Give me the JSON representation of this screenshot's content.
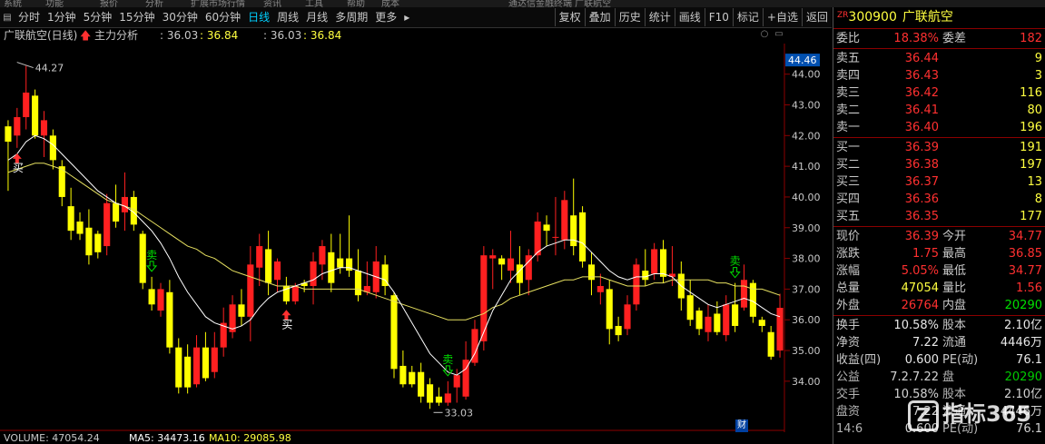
{
  "top_strip": [
    "系统",
    "功能",
    "报价",
    "分析",
    "扩展市场行情",
    "资讯",
    "工具",
    "帮助",
    "成本",
    "通达信金融终端 广联航空"
  ],
  "toolbar": {
    "periods": [
      "分时",
      "1分钟",
      "5分钟",
      "15分钟",
      "30分钟",
      "60分钟",
      "日线",
      "周线",
      "月线",
      "多周期",
      "更多"
    ],
    "active_period": "日线",
    "more_arrow": "▸",
    "tools": [
      "复权",
      "叠加",
      "历史",
      "统计",
      "画线",
      "F10",
      "标记",
      "+自选",
      "返回"
    ]
  },
  "infobar": {
    "title": "广联航空(日线)",
    "indicator": "主力分析",
    "val1": ": 36.03",
    "val2": ": 36.84",
    "val3": ": 36.03",
    "val4": ": 36.84"
  },
  "chart_data": {
    "type": "candlestick",
    "ylim": [
      33.7,
      44.7
    ],
    "yticks": [
      "44.00",
      "43.00",
      "42.00",
      "41.00",
      "40.00",
      "39.00",
      "38.00",
      "37.00",
      "36.00",
      "35.00",
      "34.00"
    ],
    "current_price_label": "44.46",
    "annotations": {
      "high_label": "44.27",
      "low_label": "33.03",
      "buy_label": "买",
      "sell_label": "卖"
    },
    "candles": [
      [
        42.3,
        41.8,
        42.5,
        40.2
      ],
      [
        42.0,
        42.6,
        42.9,
        41.6
      ],
      [
        42.6,
        43.4,
        44.27,
        42.2
      ],
      [
        43.3,
        42.0,
        43.5,
        41.9
      ],
      [
        42.0,
        42.5,
        42.8,
        41.3
      ],
      [
        42.0,
        41.2,
        42.2,
        40.9
      ],
      [
        41.0,
        40.0,
        41.2,
        39.7
      ],
      [
        39.7,
        38.9,
        40.3,
        38.6
      ],
      [
        39.2,
        38.8,
        39.5,
        38.6
      ],
      [
        39.0,
        38.1,
        39.6,
        37.8
      ],
      [
        38.8,
        38.2,
        38.9,
        38.0
      ],
      [
        38.4,
        39.8,
        40.1,
        38.1
      ],
      [
        39.8,
        39.2,
        40.4,
        39.0
      ],
      [
        39.5,
        40.0,
        40.8,
        38.9
      ],
      [
        40.0,
        39.1,
        40.2,
        38.9
      ],
      [
        38.8,
        37.2,
        38.9,
        37.0
      ],
      [
        37.0,
        36.5,
        37.4,
        36.3
      ],
      [
        36.3,
        37.0,
        37.2,
        36.1
      ],
      [
        36.9,
        35.1,
        37.3,
        34.9
      ],
      [
        35.1,
        33.8,
        35.4,
        33.6
      ],
      [
        34.8,
        33.8,
        35.2,
        33.6
      ],
      [
        33.9,
        35.1,
        35.5,
        33.8
      ],
      [
        35.1,
        34.1,
        35.6,
        34.0
      ],
      [
        34.3,
        35.1,
        35.6,
        34.1
      ],
      [
        35.1,
        35.9,
        36.4,
        34.8
      ],
      [
        35.6,
        36.5,
        36.8,
        35.4
      ],
      [
        36.5,
        36.1,
        37.0,
        35.8
      ],
      [
        36.1,
        37.8,
        38.4,
        35.3
      ],
      [
        37.7,
        38.4,
        38.8,
        37.1
      ],
      [
        38.3,
        37.2,
        38.9,
        36.8
      ],
      [
        37.3,
        37.9,
        38.0,
        36.9
      ],
      [
        37.1,
        36.6,
        37.4,
        36.5
      ],
      [
        36.6,
        37.1,
        37.2,
        36.5
      ],
      [
        37.2,
        37.1,
        37.3,
        36.9
      ],
      [
        37.1,
        37.9,
        38.2,
        36.5
      ],
      [
        37.8,
        38.4,
        38.6,
        37.3
      ],
      [
        38.2,
        37.2,
        38.8,
        36.9
      ],
      [
        38.0,
        37.7,
        38.8,
        37.5
      ],
      [
        38.0,
        37.6,
        39.4,
        37.4
      ],
      [
        37.6,
        36.8,
        38.3,
        36.6
      ],
      [
        36.9,
        37.1,
        37.9,
        36.8
      ],
      [
        36.9,
        37.9,
        38.4,
        36.7
      ],
      [
        37.8,
        37.1,
        38.1,
        36.8
      ],
      [
        36.8,
        34.4,
        36.9,
        34.1
      ],
      [
        34.5,
        33.9,
        35.0,
        33.8
      ],
      [
        34.3,
        33.9,
        34.5,
        33.8
      ],
      [
        34.3,
        33.5,
        34.6,
        33.3
      ],
      [
        33.9,
        33.3,
        34.1,
        33.1
      ],
      [
        33.5,
        33.3,
        33.8,
        33.2
      ],
      [
        33.3,
        33.6,
        34.0,
        33.2
      ],
      [
        33.8,
        34.2,
        34.4,
        33.3
      ],
      [
        33.5,
        34.7,
        35.3,
        33.4
      ],
      [
        34.6,
        35.7,
        36.0,
        34.5
      ],
      [
        35.3,
        38.1,
        38.4,
        35.0
      ],
      [
        38.0,
        38.1,
        38.3,
        37.0
      ],
      [
        38.0,
        37.8,
        38.1,
        37.3
      ],
      [
        37.6,
        38.0,
        38.9,
        37.2
      ],
      [
        37.8,
        37.2,
        38.4,
        36.8
      ],
      [
        37.3,
        38.1,
        38.3,
        36.8
      ],
      [
        38.1,
        39.2,
        39.5,
        37.9
      ],
      [
        39.1,
        38.9,
        39.4,
        38.4
      ],
      [
        38.7,
        38.7,
        40.0,
        38.1
      ],
      [
        38.6,
        39.9,
        40.2,
        38.3
      ],
      [
        39.4,
        38.4,
        40.6,
        38.1
      ],
      [
        39.5,
        37.9,
        39.7,
        37.7
      ],
      [
        37.8,
        37.3,
        38.2,
        36.8
      ],
      [
        36.9,
        37.1,
        37.5,
        36.5
      ],
      [
        37.0,
        35.7,
        37.3,
        35.2
      ],
      [
        35.8,
        35.5,
        36.1,
        35.3
      ],
      [
        35.7,
        36.5,
        36.8,
        35.5
      ],
      [
        36.5,
        37.8,
        38.0,
        36.3
      ],
      [
        37.6,
        37.3,
        38.3,
        37.1
      ],
      [
        37.5,
        38.3,
        38.5,
        37.3
      ],
      [
        38.3,
        37.4,
        38.6,
        37.2
      ],
      [
        37.4,
        37.5,
        38.4,
        37.1
      ],
      [
        37.5,
        36.7,
        37.9,
        36.3
      ],
      [
        36.8,
        36.0,
        37.3,
        35.8
      ],
      [
        36.3,
        35.7,
        36.4,
        35.5
      ],
      [
        35.6,
        36.1,
        36.5,
        35.3
      ],
      [
        36.2,
        35.6,
        36.6,
        35.5
      ],
      [
        35.5,
        36.5,
        36.8,
        35.3
      ],
      [
        36.5,
        35.8,
        37.2,
        35.6
      ],
      [
        36.4,
        37.3,
        37.8,
        36.3
      ],
      [
        37.2,
        36.1,
        37.3,
        35.9
      ],
      [
        36.0,
        35.8,
        36.1,
        35.6
      ],
      [
        35.6,
        34.8,
        35.8,
        34.7
      ],
      [
        35.0,
        36.39,
        36.85,
        34.77
      ]
    ],
    "ma": [
      41.2,
      41.4,
      41.8,
      42.0,
      41.9,
      41.7,
      41.4,
      41.1,
      40.8,
      40.5,
      40.2,
      40.0,
      39.8,
      39.7,
      39.5,
      39.2,
      38.9,
      38.5,
      38.0,
      37.4,
      36.9,
      36.5,
      36.1,
      35.9,
      35.8,
      35.7,
      35.8,
      36.0,
      36.4,
      36.7,
      36.9,
      37.0,
      37.1,
      37.2,
      37.3,
      37.5,
      37.6,
      37.7,
      37.7,
      37.6,
      37.5,
      37.4,
      37.3,
      36.9,
      36.4,
      35.9,
      35.4,
      34.9,
      34.6,
      34.3,
      34.2,
      34.4,
      34.9,
      35.6,
      36.3,
      36.8,
      37.3,
      37.6,
      37.9,
      38.2,
      38.4,
      38.5,
      38.6,
      38.6,
      38.5,
      38.2,
      37.9,
      37.6,
      37.4,
      37.3,
      37.4,
      37.4,
      37.5,
      37.5,
      37.4,
      37.1,
      36.9,
      36.7,
      36.5,
      36.4,
      36.5,
      36.6,
      36.7,
      36.6,
      36.4,
      36.2,
      36.1
    ],
    "ma2": [
      40.8,
      40.9,
      41.0,
      41.1,
      41.1,
      41.0,
      40.9,
      40.7,
      40.5,
      40.3,
      40.1,
      39.9,
      39.8,
      39.7,
      39.6,
      39.4,
      39.2,
      39.0,
      38.8,
      38.6,
      38.4,
      38.3,
      38.1,
      38.0,
      37.8,
      37.6,
      37.5,
      37.4,
      37.3,
      37.2,
      37.1,
      37.1,
      37.1,
      37.0,
      37.0,
      37.0,
      37.0,
      37.0,
      37.0,
      37.0,
      36.9,
      36.8,
      36.7,
      36.6,
      36.5,
      36.4,
      36.3,
      36.2,
      36.1,
      36.0,
      36.0,
      36.0,
      36.1,
      36.2,
      36.4,
      36.5,
      36.7,
      36.8,
      36.9,
      37.0,
      37.1,
      37.2,
      37.3,
      37.3,
      37.4,
      37.4,
      37.4,
      37.3,
      37.2,
      37.1,
      37.1,
      37.1,
      37.2,
      37.2,
      37.3,
      37.3,
      37.3,
      37.3,
      37.3,
      37.2,
      37.2,
      37.1,
      37.1,
      37.0,
      37.0,
      36.9,
      36.8
    ],
    "buy_marks": [
      1,
      31
    ],
    "sell_marks": [
      16,
      49,
      81
    ]
  },
  "quote": {
    "code": "300900",
    "name": "广联航空",
    "zr": "ZR",
    "weibi_label": "委比",
    "weibi": "18.38%",
    "weicha_label": "委差",
    "weicha": "182",
    "sells": [
      {
        "label": "卖五",
        "price": "36.44",
        "vol": "9"
      },
      {
        "label": "卖四",
        "price": "36.43",
        "vol": "3"
      },
      {
        "label": "卖三",
        "price": "36.42",
        "vol": "116"
      },
      {
        "label": "卖二",
        "price": "36.41",
        "vol": "80"
      },
      {
        "label": "卖一",
        "price": "36.40",
        "vol": "196"
      }
    ],
    "buys": [
      {
        "label": "买一",
        "price": "36.39",
        "vol": "191"
      },
      {
        "label": "买二",
        "price": "36.38",
        "vol": "197"
      },
      {
        "label": "买三",
        "price": "36.37",
        "vol": "13"
      },
      {
        "label": "买四",
        "price": "36.36",
        "vol": "8"
      },
      {
        "label": "买五",
        "price": "36.35",
        "vol": "177"
      }
    ],
    "stats": [
      {
        "l1": "现价",
        "v1": "36.39",
        "c1": "red",
        "l2": "今开",
        "v2": "34.77",
        "c2": "red"
      },
      {
        "l1": "涨跌",
        "v1": "1.75",
        "c1": "red",
        "l2": "最高",
        "v2": "36.85",
        "c2": "red"
      },
      {
        "l1": "涨幅",
        "v1": "5.05%",
        "c1": "red",
        "l2": "最低",
        "v2": "34.77",
        "c2": "red"
      },
      {
        "l1": "总量",
        "v1": "47054",
        "c1": "yellow",
        "l2": "量比",
        "v2": "1.56",
        "c2": "red"
      },
      {
        "l1": "外盘",
        "v1": "26764",
        "c1": "red",
        "l2": "内盘",
        "v2": "20290",
        "c2": "green"
      }
    ],
    "stats2": [
      {
        "l1": "换手",
        "v1": "10.58%",
        "l2": "股本",
        "v2": "2.10亿"
      },
      {
        "l1": "净资",
        "v1": "7.22",
        "l2": "流通",
        "v2": "4446万"
      },
      {
        "l1": "收益(四)",
        "v1": "0.600",
        "l2": "PE(动)",
        "v2": "76.1"
      }
    ],
    "ghost": [
      {
        "l1": "公益",
        "v1": "7.2.7.22",
        "l2": "盘",
        "v2": "20290",
        "c2": "green"
      },
      {
        "l1": "交手",
        "v1": "10.58%",
        "l2": "股本",
        "v2": "2.10亿"
      },
      {
        "l1": "盘资",
        "v1": "7.22",
        "l2": "流通",
        "v2": "4446万"
      },
      {
        "l1": "14:6",
        "v1": "0.600",
        "l2": "PE(动)",
        "v2": "76.1"
      }
    ]
  },
  "volume": {
    "label": "VOLUME: 47054.24",
    "ma5": "MA5: 34473.16",
    "ma10": "MA10: 29085.98"
  },
  "cai_label": "财",
  "watermark": {
    "z": "Z",
    "text": "指标365"
  },
  "colors": {
    "up": "#ff2020",
    "down": "#ffff00",
    "ma": "#ffffff",
    "ma2": "#e6e060",
    "axis": "#8b0000"
  }
}
